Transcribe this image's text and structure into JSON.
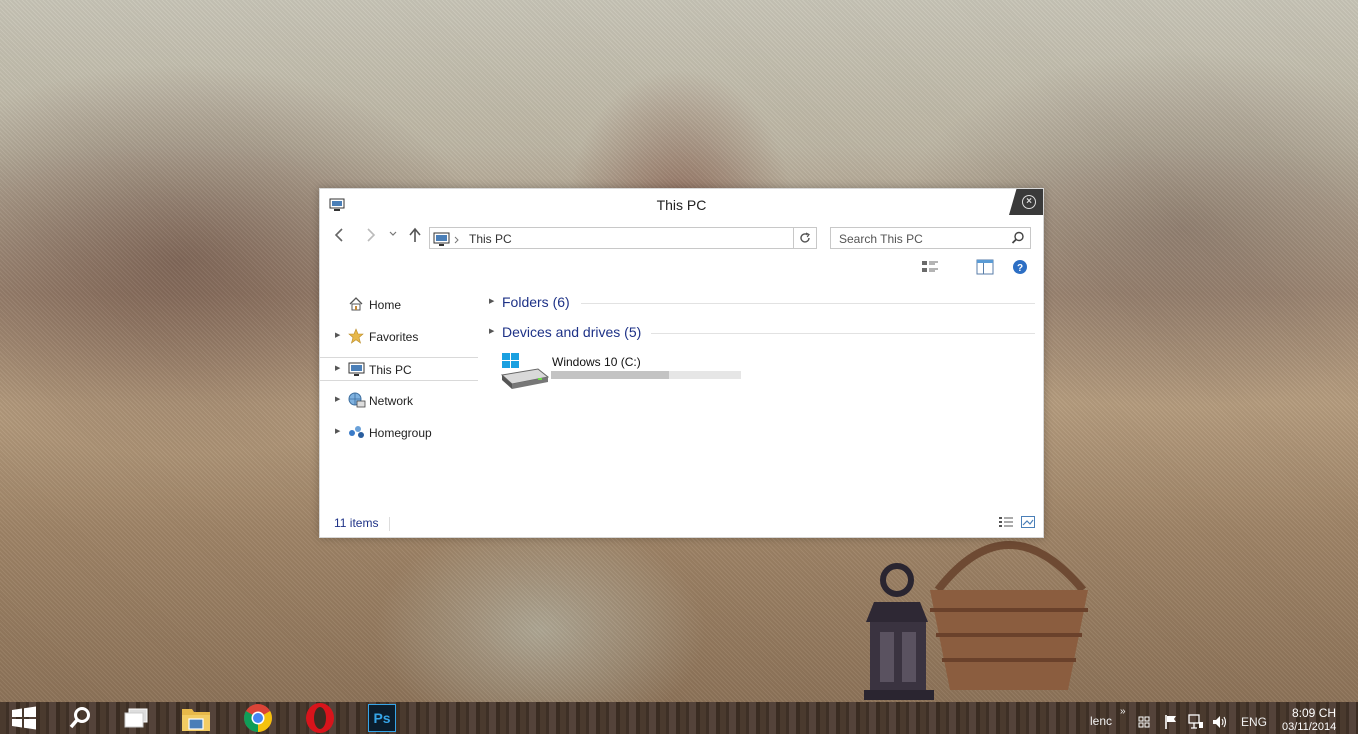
{
  "window": {
    "title": "This PC",
    "close_symbol": "×"
  },
  "navigation": {
    "back_icon": "back-arrow-icon",
    "forward_icon": "forward-arrow-icon",
    "up_icon": "up-arrow-icon",
    "address_text": "This PC",
    "search_placeholder": "Search This PC"
  },
  "sidebar": {
    "items": [
      {
        "label": "Home",
        "icon": "home-icon",
        "expandable": false
      },
      {
        "label": "Favorites",
        "icon": "star-icon",
        "expandable": true
      },
      {
        "label": "This PC",
        "icon": "computer-icon",
        "expandable": true,
        "selected": true
      },
      {
        "label": "Network",
        "icon": "network-icon",
        "expandable": true
      },
      {
        "label": "Homegroup",
        "icon": "homegroup-icon",
        "expandable": true
      }
    ]
  },
  "content": {
    "groups": [
      {
        "label": "Folders (6)",
        "collapsed": true
      },
      {
        "label": "Devices and drives (5)",
        "collapsed": false
      }
    ],
    "drives": [
      {
        "name": "Windows 10 (C:)",
        "used_fraction": 0.62
      }
    ]
  },
  "status": {
    "item_count": "11 items"
  },
  "taskbar": {
    "apps": [
      "start-icon",
      "search-icon",
      "task-view-icon",
      "file-explorer-icon",
      "chrome-icon",
      "opera-icon",
      "photoshop-icon"
    ],
    "photoshop_label": "Ps",
    "tray_label": "lenc",
    "language": "ENG",
    "time": "8:09 CH",
    "date": "03/11/2014"
  },
  "colors": {
    "accent_blue": "#1e3287",
    "close_bg": "#3a3a3a",
    "windows_logo": "#1aa0e0"
  }
}
